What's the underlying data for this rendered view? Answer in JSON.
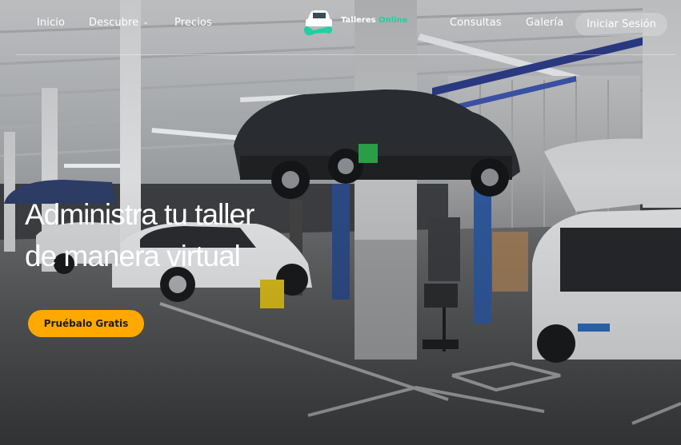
{
  "nav": {
    "items": [
      {
        "label": "Inicio"
      },
      {
        "label": "Descubre",
        "dropdown": true
      },
      {
        "label": "Precios"
      },
      {
        "label": "Consultas"
      },
      {
        "label": "Galería"
      }
    ],
    "login_label": "Iniciar Sesión"
  },
  "logo": {
    "name_main": "Talleres",
    "name_accent": "Online",
    "icon": "car-wrench-icon",
    "accent_color": "#1fd1a0"
  },
  "hero": {
    "headline_line1": "Administra tu taller",
    "headline_line2": "de manera virtual",
    "cta_label": "Pruébalo Gratis",
    "cta_color": "#ffa800",
    "background": "car-workshop-photo"
  }
}
